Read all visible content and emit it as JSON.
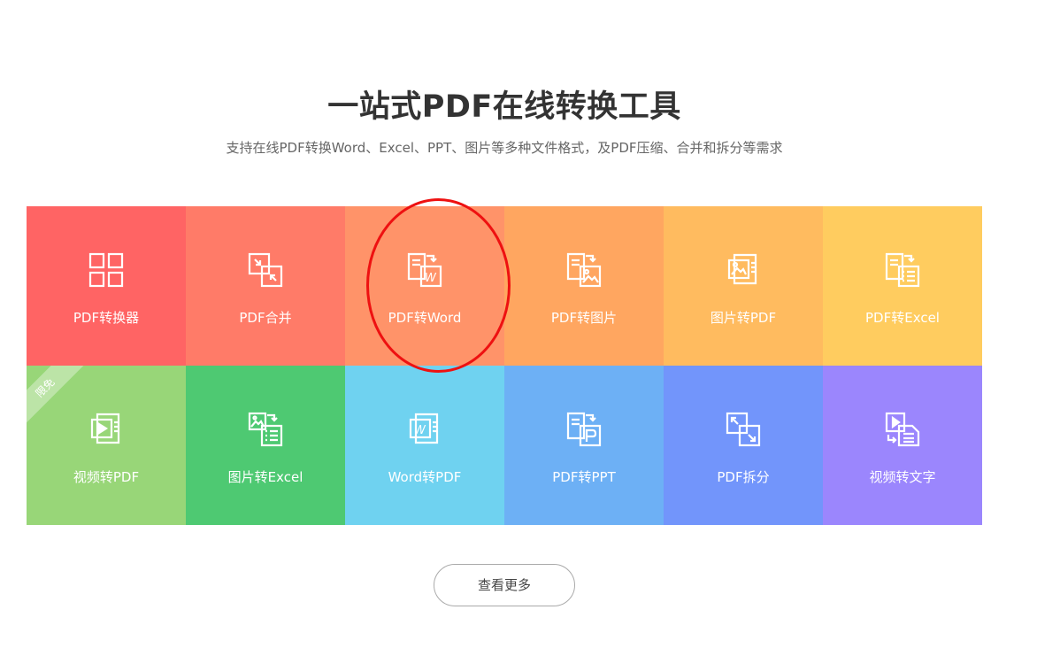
{
  "title": "一站式PDF在线转换工具",
  "subtitle": "支持在线PDF转换Word、Excel、PPT、图片等多种文件格式，及PDF压缩、合并和拆分等需求",
  "tiles": [
    {
      "label": "PDF转换器",
      "color": "#ff6464",
      "icon": "grid-icon"
    },
    {
      "label": "PDF合并",
      "color": "#ff7b68",
      "icon": "merge-icon"
    },
    {
      "label": "PDF转Word",
      "color": "#ff9369",
      "icon": "pdf-to-word-icon"
    },
    {
      "label": "PDF转图片",
      "color": "#ffa660",
      "icon": "pdf-to-image-icon"
    },
    {
      "label": "图片转PDF",
      "color": "#ffbb5f",
      "icon": "image-to-pdf-icon"
    },
    {
      "label": "PDF转Excel",
      "color": "#ffcc5f",
      "icon": "pdf-to-excel-icon"
    },
    {
      "label": "视频转PDF",
      "color": "#98d678",
      "icon": "video-to-pdf-icon",
      "badge": "限免"
    },
    {
      "label": "图片转Excel",
      "color": "#4ec972",
      "icon": "image-to-excel-icon"
    },
    {
      "label": "Word转PDF",
      "color": "#6fd2f0",
      "icon": "word-to-pdf-icon"
    },
    {
      "label": "PDF转PPT",
      "color": "#6db0f5",
      "icon": "pdf-to-ppt-icon"
    },
    {
      "label": "PDF拆分",
      "color": "#7295fb",
      "icon": "split-icon"
    },
    {
      "label": "视频转文字",
      "color": "#9b86fd",
      "icon": "video-to-text-icon"
    }
  ],
  "more_button": "查看更多",
  "highlight_color": "#ee1111"
}
